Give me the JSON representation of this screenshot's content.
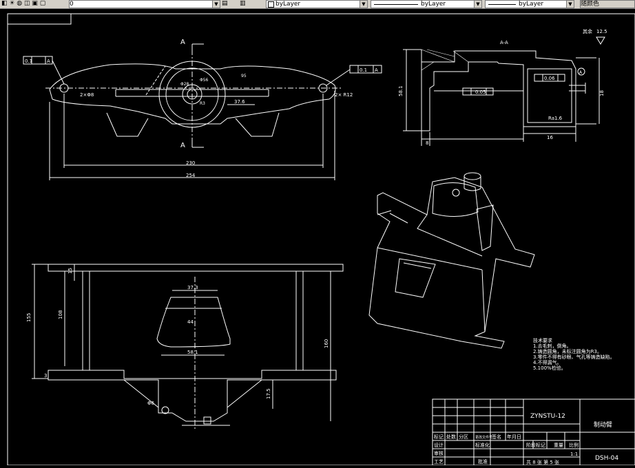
{
  "toolbar": {
    "layer_value": "0",
    "color_value": "byLayer",
    "linetype_value": "byLayer",
    "lineweight_value": "byLayer",
    "plotstyle_value": "随颜色"
  },
  "drawing": {
    "section_label": "A",
    "section_title": "A-A",
    "roughness": "其余",
    "roughness_value": "12.5",
    "tol1": "0.1",
    "tol2": "0.1",
    "tol3": "0.05",
    "tol4": "0.06",
    "datum": "A",
    "dim_230": "230",
    "dim_254": "254",
    "dim_376": "37.6",
    "dim_373": "37.3",
    "dim_175": "17.5",
    "dim_581": "58.1",
    "dim_18": "18",
    "dim_16": "16",
    "dim_r12": "2× R12",
    "dim_2phi": "2×Φ8",
    "dim_phi6": "Φ6",
    "dim_160": "160",
    "dim_155": "155",
    "dim_108": "108",
    "dim_95": "95",
    "dim_15": "15",
    "dim_8": "8",
    "dim_44": "44",
    "dim_3": "3",
    "dim_phi56": "Φ56",
    "dim_phi28": "Φ28",
    "dim_r3": "R3",
    "dim_ra": "Ra1.6"
  },
  "tech": {
    "title": "技术要求",
    "items": [
      "1.去毛刺，倒角。",
      "2.铸造圆角，未标注圆角为R3。",
      "3.零件不得有砂眼、气孔等铸造缺陷。",
      "4.不得漏气。",
      "5.100%检验。"
    ]
  },
  "title_block": {
    "drawing_no": "ZYNSTU-12",
    "part_name": "制动臂",
    "part_code": "DSH-04",
    "scale": "1:1",
    "sheet": "共 8 张 第 5 张",
    "r_mark": "标记",
    "r_count": "处数",
    "r_zone": "分区",
    "r_file": "更改文件号",
    "r_sign": "签名",
    "r_date": "年月日",
    "design": "设计",
    "std": "标准化",
    "stage_mark": "阶段标记",
    "weight": "重量",
    "ratio": "比例",
    "review": "审核",
    "process": "工艺",
    "approve": "批准"
  }
}
